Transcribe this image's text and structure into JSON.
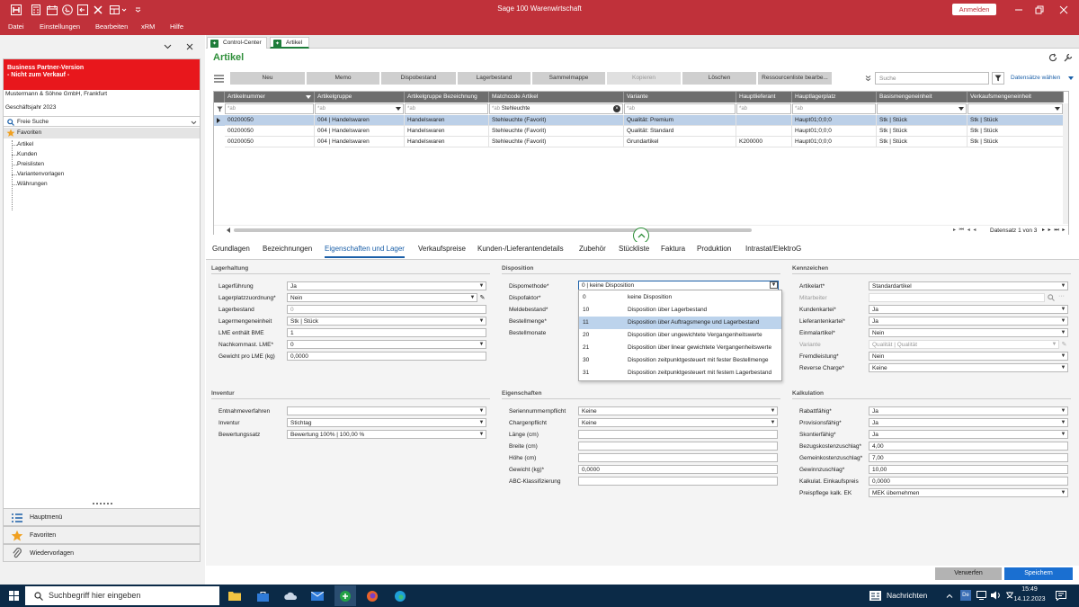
{
  "app": {
    "title": "Sage 100 Warenwirtschaft",
    "login": "Anmelden"
  },
  "menu": [
    "Datei",
    "Einstellungen",
    "Bearbeiten",
    "xRM",
    "Hilfe"
  ],
  "left": {
    "banner": [
      "Business Partner-Version",
      "- Nicht zum Verkauf -"
    ],
    "company": "Mustermann & Söhne GmbH, Frankfurt",
    "year": "Geschäftsjahr 2023",
    "search": "Freie Suche",
    "favorites": "Favoriten",
    "tree": [
      "Artikel",
      "Kunden",
      "Preislisten",
      "Variantenvorlagen",
      "Währungen"
    ],
    "nav": [
      "Hauptmenü",
      "Favoriten",
      "Wiedervorlagen"
    ]
  },
  "tabs": [
    "Control-Center",
    "Artikel"
  ],
  "page": {
    "title": "Artikel"
  },
  "toolbar": {
    "buttons": [
      "Neu",
      "Memo",
      "Dispobestand",
      "Lagerbestand",
      "Sammelmappe",
      "Kopieren",
      "Löschen",
      "Ressourcenliste bearbe..."
    ],
    "search_placeholder": "Suche",
    "select_records": "Datensätze wählen"
  },
  "grid": {
    "columns": [
      "Artikelnummer",
      "Artikelgruppe",
      "Artikelgruppe Bezeichnung",
      "Matchcode Artikel",
      "Variante",
      "Hauptlieferant",
      "Hauptlagerplatz",
      "Basismengeneinheit",
      "Verkaufsmengeneinheit"
    ],
    "filter_tag": "*ab",
    "filter_matchcode": "Stehleuchte",
    "rows": [
      [
        "00200050",
        "004 | Handelswaren",
        "Handelswaren",
        "Stehleuchte (Favorit)",
        "Qualität: Premium",
        "",
        "Haupt01;0;0;0",
        "Stk | Stück",
        "Stk | Stück"
      ],
      [
        "00200050",
        "004 | Handelswaren",
        "Handelswaren",
        "Stehleuchte (Favorit)",
        "Qualität: Standard",
        "",
        "Haupt01;0;0;0",
        "Stk | Stück",
        "Stk | Stück"
      ],
      [
        "00200050",
        "004 | Handelswaren",
        "Handelswaren",
        "Stehleuchte (Favorit)",
        "Grundartikel",
        "K200000",
        "Haupt01;0;0;0",
        "Stk | Stück",
        "Stk | Stück"
      ]
    ],
    "record_info": "Datensatz 1 von 3"
  },
  "detail": {
    "tabs": [
      "Grundlagen",
      "Bezeichnungen",
      "Eigenschaften und Lager",
      "Verkaufspreise",
      "Kunden-/Lieferantendetails",
      "Zubehör",
      "Stückliste",
      "Faktura",
      "Produktion",
      "Intrastat/ElektroG"
    ],
    "lagerhaltung": {
      "title": "Lagerhaltung",
      "fields": [
        {
          "label": "Lagerführung",
          "value": "Ja"
        },
        {
          "label": "Lagerplatzzuordnung*",
          "value": "Nein"
        },
        {
          "label": "Lagerbestand",
          "value": "0"
        },
        {
          "label": "Lagermengeneinheit",
          "value": "Stk | Stück"
        },
        {
          "label": "LME enthält BME",
          "value": "1"
        },
        {
          "label": "Nachkommast. LME*",
          "value": "0"
        },
        {
          "label": "Gewicht pro LME (kg)",
          "value": "0,0000"
        }
      ]
    },
    "inventur": {
      "title": "Inventur",
      "fields": [
        {
          "label": "Entnahmeverfahren",
          "value": ""
        },
        {
          "label": "Inventur",
          "value": "Stichtag"
        },
        {
          "label": "Bewertungssatz",
          "value": "Bewertung 100% | 100,00 %"
        }
      ]
    },
    "disposition": {
      "title": "Disposition",
      "fields": [
        {
          "label": "Dispomethode*",
          "value": "0 | keine Disposition"
        },
        {
          "label": "Dispofaktor*",
          "value": ""
        },
        {
          "label": "Meldebestand*",
          "value": ""
        },
        {
          "label": "Bestellmenge*",
          "value": ""
        },
        {
          "label": "Bestellmonate",
          "value": ""
        }
      ],
      "options": [
        [
          "0",
          "keine Disposition"
        ],
        [
          "10",
          "Disposition über Lagerbestand"
        ],
        [
          "11",
          "Disposition über Auftragsmenge und Lagerbestand"
        ],
        [
          "20",
          "Disposition über ungewichtete Vergangenheitswerte"
        ],
        [
          "21",
          "Disposition über linear gewichtete Vergangenheitswerte"
        ],
        [
          "30",
          "Disposition zeitpunktgesteuert mit fester Bestellmenge"
        ],
        [
          "31",
          "Disposition zeitpunktgesteuert mit festem Lagerbestand"
        ]
      ]
    },
    "eigenschaften": {
      "title": "Eigenschaften",
      "fields": [
        {
          "label": "Seriennummernpflicht",
          "value": "Keine"
        },
        {
          "label": "Chargenpflicht",
          "value": "Keine"
        },
        {
          "label": "Länge (cm)",
          "value": ""
        },
        {
          "label": "Breite (cm)",
          "value": ""
        },
        {
          "label": "Höhe (cm)",
          "value": ""
        },
        {
          "label": "Gewicht (kg)*",
          "value": "0,0000"
        },
        {
          "label": "ABC-Klassifizierung",
          "value": ""
        }
      ]
    },
    "kennzeichen": {
      "title": "Kennzeichen",
      "fields": [
        {
          "label": "Artikelart*",
          "value": "Standardartikel"
        },
        {
          "label": "Mitarbeiter",
          "value": ""
        },
        {
          "label": "Kundenkartei*",
          "value": "Ja"
        },
        {
          "label": "Lieferantenkartei*",
          "value": "Ja"
        },
        {
          "label": "Einmalartikel*",
          "value": "Nein"
        },
        {
          "label": "Variante",
          "value": "Qualität | Qualität"
        },
        {
          "label": "Fremdleistung*",
          "value": "Nein"
        },
        {
          "label": "Reverse Charge*",
          "value": "Keine"
        }
      ]
    },
    "kalkulation": {
      "title": "Kalkulation",
      "fields": [
        {
          "label": "Rabattfähig*",
          "value": "Ja"
        },
        {
          "label": "Provisionsfähig*",
          "value": "Ja"
        },
        {
          "label": "Skontierfähig*",
          "value": "Ja"
        },
        {
          "label": "Bezugskostenzuschlag*",
          "value": "4,00"
        },
        {
          "label": "Gemeinkostenzuschlag*",
          "value": "7,00"
        },
        {
          "label": "Gewinnzuschlag*",
          "value": "10,00"
        },
        {
          "label": "Kalkulat. Einkaufspreis",
          "value": "0,0000"
        },
        {
          "label": "Preispflege kalk. EK",
          "value": "MEK übernehmen"
        }
      ]
    }
  },
  "footer": {
    "discard": "Verwerfen",
    "save": "Speichern"
  },
  "taskbar": {
    "search": "Suchbegriff hier eingeben",
    "news": "Nachrichten",
    "time": "15:49",
    "date": "14.12.2023"
  },
  "colors": {
    "brand": "#c0313a",
    "accent_green": "#2f8f3a",
    "banner_red": "#e8171c",
    "save_blue": "#1a6fd1",
    "taskbar": "#0b2a47"
  }
}
